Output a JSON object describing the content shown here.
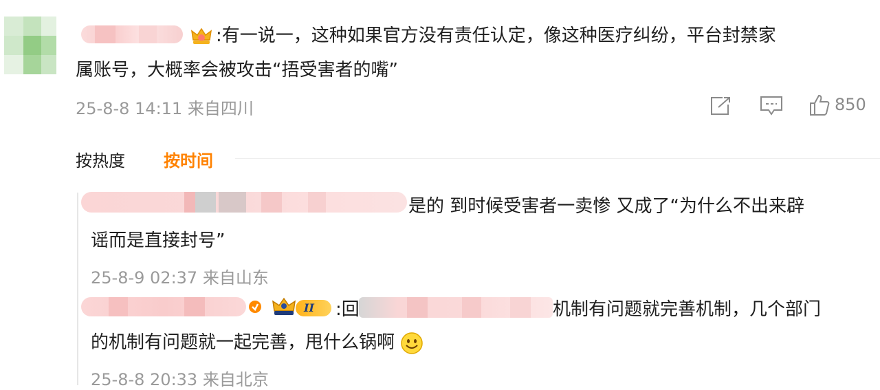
{
  "main_comment": {
    "text_line1": ":有一说一，这种如果官方没有责任认定，像这种医疗纠纷，平台封禁家",
    "text_line2": "属账号，大概率会被攻击“捂受害者的嘴”",
    "meta": "25-8-8 14:11 来自四川",
    "like_count": "850"
  },
  "sort_tabs": {
    "by_heat": "按热度",
    "by_time": "按时间"
  },
  "replies": [
    {
      "text_line1": "是的 到时候受害者一卖惨 又成了“为什么不出来辟",
      "text_line2": "谣而是直接封号”",
      "meta": "25-8-9 02:37 来自山东"
    },
    {
      "badge_text": "II",
      "prefix": ":回",
      "text_line1": "机制有问题就完善机制，几个部门",
      "text_line2": "的机制有问题就一起完善，甩什么锅啊",
      "meta": "25-8-8 20:33 来自北京"
    }
  ],
  "colors": {
    "accent": "#ff8200",
    "meta": "#9a9a9a",
    "text": "#1f1f1f"
  },
  "icons": [
    "share-icon",
    "comment-icon",
    "like-icon",
    "crown-icon",
    "smile-emoji-icon"
  ]
}
